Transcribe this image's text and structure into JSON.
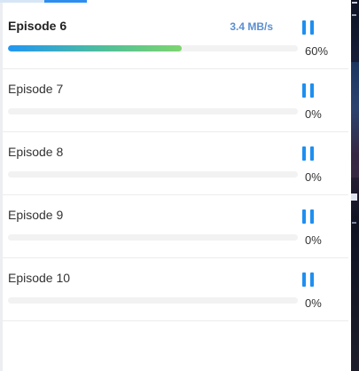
{
  "downloads": [
    {
      "title": "Episode 6",
      "speed": "3.4 MB/s",
      "progress_percent": 60,
      "progress_label": "60%",
      "state": "downloading"
    },
    {
      "title": "Episode 7",
      "speed": "",
      "progress_percent": 0,
      "progress_label": "0%",
      "state": "queued"
    },
    {
      "title": "Episode 8",
      "speed": "",
      "progress_percent": 0,
      "progress_label": "0%",
      "state": "queued"
    },
    {
      "title": "Episode 9",
      "speed": "",
      "progress_percent": 0,
      "progress_label": "0%",
      "state": "queued"
    },
    {
      "title": "Episode 10",
      "speed": "",
      "progress_percent": 0,
      "progress_label": "0%",
      "state": "queued"
    }
  ],
  "icons": {
    "pause": "pause-icon"
  },
  "colors": {
    "accent": "#1e8ff0",
    "speed_text": "#5b8fd0",
    "progress_start": "#2196f3",
    "progress_end": "#7ed56f"
  }
}
